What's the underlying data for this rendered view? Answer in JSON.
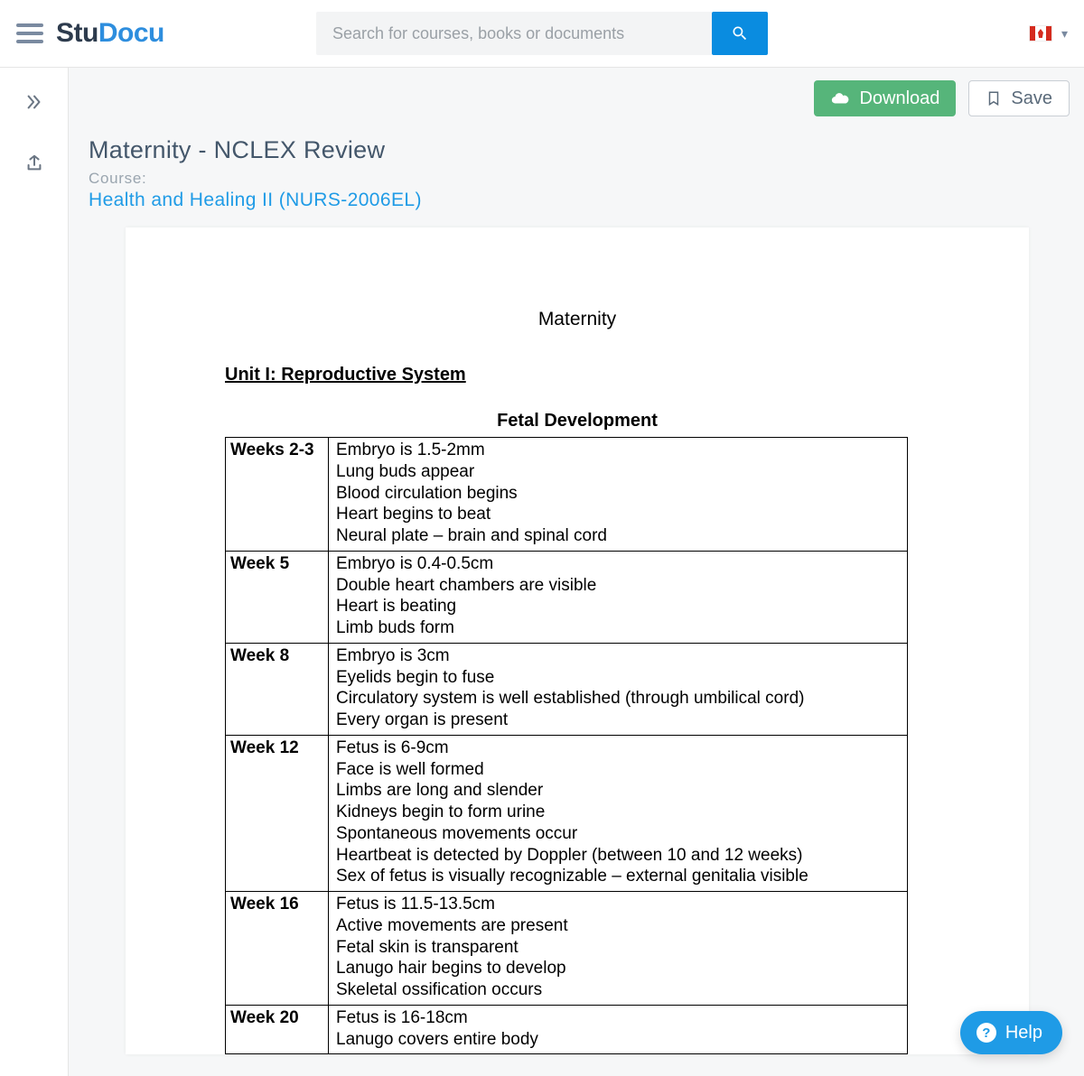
{
  "header": {
    "logo_stu": "Stu",
    "logo_docu": "Docu",
    "search_placeholder": "Search for courses, books or documents",
    "flag": "canada"
  },
  "actions": {
    "download": "Download",
    "save": "Save"
  },
  "document": {
    "title": "Maternity - NCLEX Review",
    "course_label": "Course:",
    "course_link": "Health and Healing II (NURS-2006EL)"
  },
  "paper": {
    "title": "Maternity",
    "unit_heading": "Unit I: Reproductive System ",
    "section_heading": "Fetal Development",
    "rows": [
      {
        "week": "Weeks 2-3",
        "lines": [
          "Embryo is 1.5-2mm",
          "Lung buds appear",
          "Blood circulation begins",
          "Heart begins to beat",
          "Neural plate – brain and spinal cord"
        ]
      },
      {
        "week": "Week 5",
        "lines": [
          "Embryo is 0.4-0.5cm",
          "Double heart chambers are visible",
          "Heart is beating",
          "Limb buds form"
        ]
      },
      {
        "week": "Week 8",
        "lines": [
          "Embryo is 3cm",
          "Eyelids begin to fuse",
          "Circulatory system is well established (through umbilical cord)",
          "Every organ is present"
        ]
      },
      {
        "week": "Week 12",
        "lines": [
          "Fetus is 6-9cm",
          "Face is well formed",
          "Limbs are long and slender",
          "Kidneys begin to form urine",
          "Spontaneous movements occur",
          "Heartbeat is detected by Doppler (between 10 and 12 weeks)",
          "Sex of fetus is visually recognizable – external genitalia visible"
        ]
      },
      {
        "week": "Week 16",
        "lines": [
          "Fetus is 11.5-13.5cm",
          "Active movements are present",
          "Fetal skin is transparent",
          "Lanugo hair begins to develop",
          "Skeletal ossification occurs"
        ]
      },
      {
        "week": "Week 20",
        "lines": [
          "Fetus is 16-18cm",
          "Lanugo covers entire body"
        ]
      }
    ]
  },
  "help": {
    "label": "Help"
  }
}
